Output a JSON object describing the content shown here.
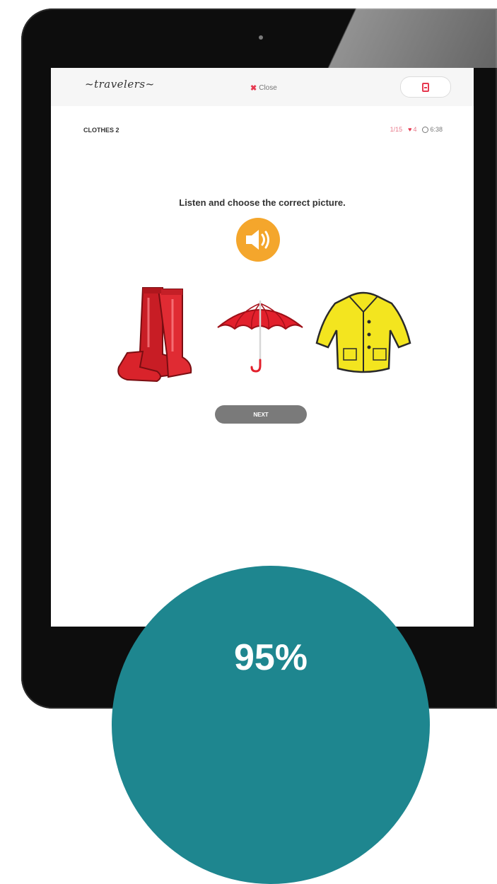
{
  "app": {
    "logo": "~travelers~"
  },
  "header": {
    "close_label": "Close"
  },
  "lesson": {
    "title": "CLOTHES 2",
    "progress": "1/15",
    "hearts": "4",
    "timer": "6:38"
  },
  "question": {
    "instruction": "Listen and choose the correct picture."
  },
  "choices": [
    {
      "name": "rubber-boots"
    },
    {
      "name": "umbrella"
    },
    {
      "name": "raincoat"
    }
  ],
  "actions": {
    "next_label": "NEXT"
  },
  "badge": {
    "value": "95%"
  },
  "colors": {
    "accent": "#e63950",
    "speaker": "#f4a62c",
    "badge": "#1e868f",
    "next_button": "#7a7a7a"
  }
}
